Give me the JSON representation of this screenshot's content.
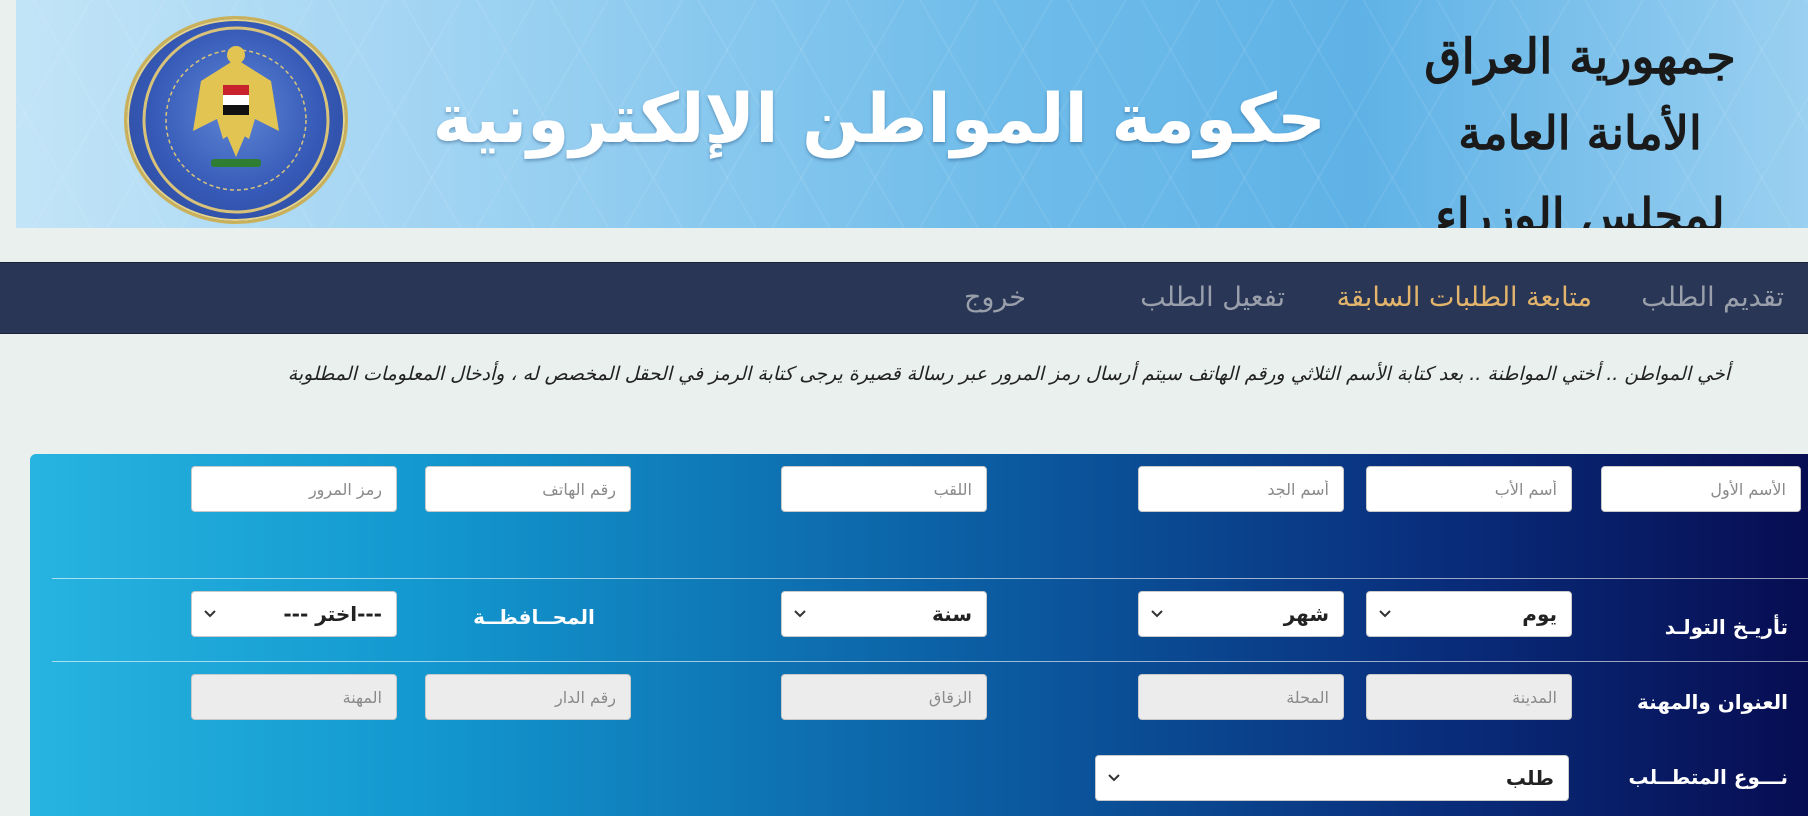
{
  "banner": {
    "title": "حكومة المواطن الإلكترونية",
    "calligraphy_line1": "جمهورية العراق",
    "calligraphy_line2": "الأمانة العامة لمجلس الوزراء"
  },
  "nav": {
    "items": [
      {
        "label": "تقديم الطلب",
        "active": false
      },
      {
        "label": "متابعة الطلبات السابقة",
        "active": true
      },
      {
        "label": "تفعيل الطلب",
        "active": false
      },
      {
        "label": "خروج",
        "active": false
      }
    ],
    "colors": {
      "background": "#2a3655",
      "active": "#e3b46c",
      "inactive": "#9aa0ab"
    }
  },
  "instruction": "أخي المواطن .. أختي المواطنة .. بعد كتابة الأسم الثلاثي ورقم الهاتف سيتم أرسال رمز المرور عبر رسالة قصيرة يرجى كتابة الرمز في الحقل المخصص له ، وأدخال المعلومات المطلوبة",
  "form": {
    "row1": {
      "first_name_placeholder": "الأسم الأول",
      "father_name_placeholder": "أسم الأب",
      "grandfather_name_placeholder": "أسم الجد",
      "surname_placeholder": "اللقب",
      "phone_placeholder": "رقم الهاتف",
      "passcode_placeholder": "رمز المرور"
    },
    "birthdate": {
      "label": "تأريـخ التولـد",
      "day": "يوم",
      "month": "شهر",
      "year": "سنة"
    },
    "governorate": {
      "label": "المحــافظــة",
      "value": "---اختر ---"
    },
    "address": {
      "label": "العنوان والمهنة",
      "city_placeholder": "المدينة",
      "district_placeholder": "المحلة",
      "alley_placeholder": "الزقاق",
      "house_placeholder": "رقم الدار",
      "job_placeholder": "المهنة"
    },
    "request_type": {
      "label": "نـــوع المتطــلب",
      "value": "طلب"
    }
  }
}
